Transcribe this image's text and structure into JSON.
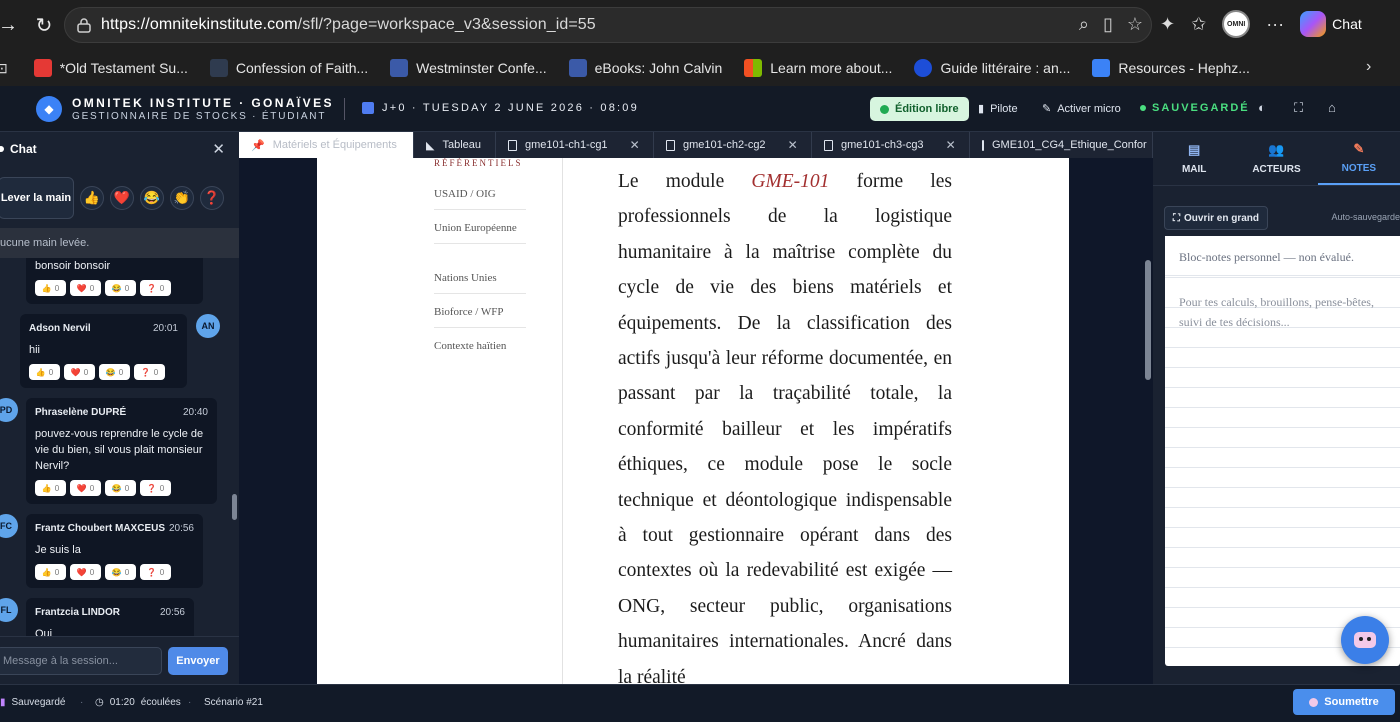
{
  "browser": {
    "url_host": "https://omnitekinstitute.com",
    "url_path": "/sfl/?page=workspace_v3&session_id=55",
    "copilot_label": "Chat",
    "profile_label": "OMNI"
  },
  "bookmarks": [
    {
      "label": "*Old Testament Su...",
      "color": "#e53935"
    },
    {
      "label": "Confession of Faith...",
      "color": "#2f3b4f"
    },
    {
      "label": "Westminster Confe...",
      "color": "#3b5aa8"
    },
    {
      "label": "eBooks: John Calvin",
      "color": "#3b5aa8"
    },
    {
      "label": "Learn more about...",
      "color": "#f25022"
    },
    {
      "label": "Guide littéraire : an...",
      "color": "#1d4ed8"
    },
    {
      "label": "Resources - Hephz...",
      "color": "#3b82f6"
    }
  ],
  "header": {
    "title": "OMNITEK INSTITUTE · GONAÏVES",
    "subtitle": "GESTIONNAIRE DE STOCKS · ÉTUDIANT",
    "date": "J+0 · TUESDAY 2 JUNE 2026 · 08:09",
    "mode": "Édition libre",
    "pilot": "Pilote",
    "mic": "Activer micro",
    "saved": "SAUVEGARDÉ"
  },
  "chat": {
    "title": "Chat",
    "raise_hand": "Lever la main",
    "reactions": [
      "👍",
      "❤️",
      "😂",
      "👏",
      "❓"
    ],
    "no_hand": "ucune main levée.",
    "input_placeholder": "Message à la session...",
    "send": "Envoyer",
    "messages": [
      {
        "author": "",
        "time": "",
        "text": "bonsoir bonsoir",
        "avatar": ""
      },
      {
        "author": "Adson Nervil",
        "time": "20:01",
        "text": "hii",
        "avatar": "AN"
      },
      {
        "author": "Phraselène DUPRÉ",
        "time": "20:40",
        "text": "pouvez-vous reprendre le cycle de vie du bien, sil vous plait monsieur Nervil?",
        "avatar": "PD"
      },
      {
        "author": "Frantz Choubert MAXCEUS",
        "time": "20:56",
        "text": "Je suis la",
        "avatar": "FC"
      },
      {
        "author": "Frantzcia LINDOR",
        "time": "20:56",
        "text": "Oui",
        "avatar": "FL"
      }
    ],
    "react_count": "0"
  },
  "tabs": [
    {
      "label": "Matériels et Équipements",
      "active": true
    },
    {
      "label": "Tableau"
    },
    {
      "label": "gme101-ch1-cg1"
    },
    {
      "label": "gme101-ch2-cg2"
    },
    {
      "label": "gme101-ch3-cg3"
    },
    {
      "label": "GME101_CG4_Ethique_Confor"
    }
  ],
  "document": {
    "side_heading": "RÉFÉRENTIELS",
    "side_items": [
      "USAID / OIG",
      "Union Européenne",
      "Nations Unies",
      "Bioforce / WFP",
      "Contexte haïtien"
    ],
    "text_before": "Le module ",
    "highlight": "GME-101",
    "text_after": " forme les professionnels de la logistique humanitaire à la maîtrise complète du cycle de vie des biens matériels et équipements. De la classification des actifs jusqu'à leur réforme documentée, en passant par la traçabilité totale, la conformité bailleur et les impératifs éthiques, ce module pose le socle technique et déontologique indispensable à tout gestionnaire opérant dans des contextes où la redevabilité est exigée — ONG, secteur public, organisations humanitaires internationales. Ancré dans la réalité"
  },
  "right_panel": {
    "tabs": [
      {
        "label": "MAIL",
        "icon": "mail-icon"
      },
      {
        "label": "ACTEURS",
        "icon": "users-icon"
      },
      {
        "label": "NOTES",
        "icon": "pencil-icon",
        "active": true
      }
    ],
    "open_big": "Ouvrir en grand",
    "autosave": "Auto-sauvegarde",
    "note_title": "Bloc-notes personnel — non évalué.",
    "note_placeholder": "Pour tes calculs, brouillons, pense-bêtes, suivi de tes décisions..."
  },
  "status": {
    "saved": "Sauvegardé",
    "elapsed_time": "01:20",
    "elapsed_label": "écoulées",
    "scenario": "Scénario #21",
    "submit": "Soumettre"
  }
}
